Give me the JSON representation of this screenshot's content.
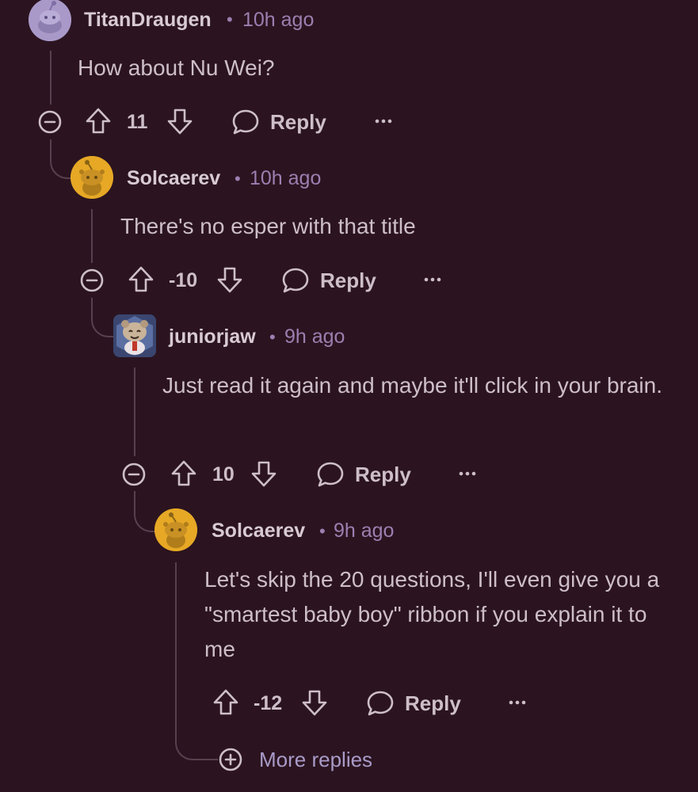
{
  "comments": [
    {
      "username": "TitanDraugen",
      "separator": "•",
      "time": "10h ago",
      "body": "How about Nu Wei?",
      "score": "11",
      "reply_label": "Reply",
      "avatar_color": "#a999c9"
    },
    {
      "username": "Solcaerev",
      "separator": "•",
      "time": "10h ago",
      "body": "There's no esper with that title",
      "score": "-10",
      "reply_label": "Reply",
      "avatar_color": "#e6a825"
    },
    {
      "username": "juniorjaw",
      "separator": "•",
      "time": "9h ago",
      "body": "Just read it again and maybe it'll click in your brain.",
      "score": "10",
      "reply_label": "Reply",
      "avatar_color": "#5b6fa3"
    },
    {
      "username": "Solcaerev",
      "separator": "•",
      "time": "9h ago",
      "body": "Let's skip the 20 questions, I'll even give you a \"smartest baby boy\" ribbon if you explain it to me",
      "score": "-12",
      "reply_label": "Reply",
      "avatar_color": "#e6a825"
    }
  ],
  "more_replies_label": "More replies",
  "colors": {
    "background": "#2b1420",
    "thread_line": "#5a3f4e",
    "meta_purple": "#9c7fb0",
    "text": "#cdbec8"
  }
}
